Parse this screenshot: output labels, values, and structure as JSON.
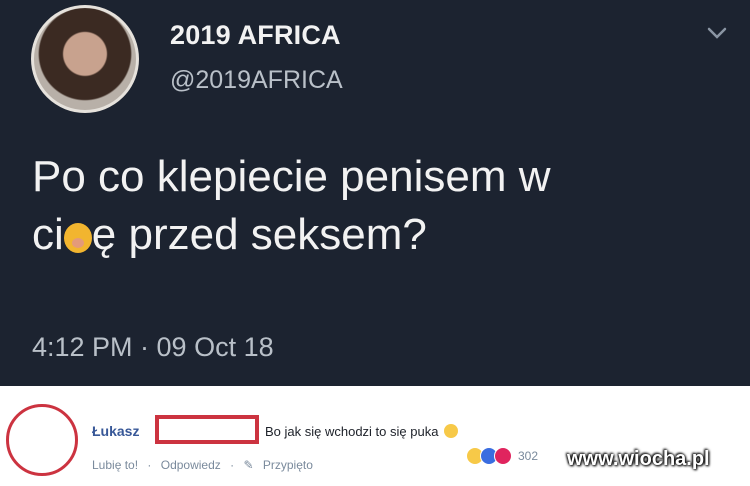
{
  "tweet": {
    "name": "2019 AFRICA",
    "handle": "@2019AFRICA",
    "text_line1": "Po co klepiecie penisem w",
    "text_line2_start": "ci",
    "text_line2_end": "ę przed seksem?",
    "timestamp": "4:12 PM · 09 Oct 18",
    "emoji_icon": "face-with-hand-over-mouth-icon"
  },
  "comment": {
    "author": "Łukasz",
    "text": "Bo jak się wchodzi to się puka",
    "actions": {
      "like": "Lubię to!",
      "reply": "Odpowiedz",
      "pinned": "Przypięto"
    },
    "reaction_count": "302",
    "colors": {
      "highlight": "#cc3340",
      "link": "#385898"
    }
  },
  "watermark": "www.wiocha.pl"
}
